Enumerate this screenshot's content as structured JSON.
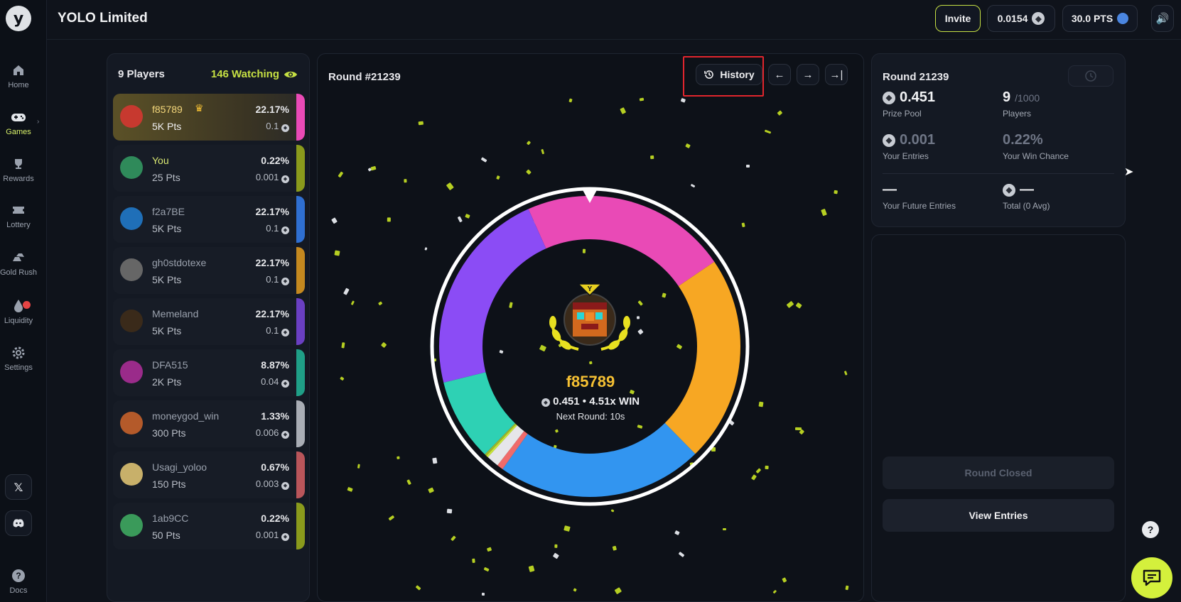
{
  "app": {
    "title": "YOLO Limited",
    "logo_letter": "y"
  },
  "sidebar": {
    "items": [
      {
        "label": "Home",
        "icon": "home-icon"
      },
      {
        "label": "Games",
        "icon": "gamepad-icon",
        "active": true
      },
      {
        "label": "Rewards",
        "icon": "trophy-icon"
      },
      {
        "label": "Lottery",
        "icon": "ticket-icon"
      },
      {
        "label": "Gold Rush",
        "icon": "gold-bars-icon"
      },
      {
        "label": "Liquidity",
        "icon": "drop-icon"
      },
      {
        "label": "Settings",
        "icon": "gear-icon"
      }
    ],
    "docs_label": "Docs",
    "social": [
      "x-icon",
      "discord-icon"
    ]
  },
  "header": {
    "invite_label": "Invite",
    "eth_balance": "0.0154",
    "points": "30.0 PTS",
    "sound_icon": "speaker-icon"
  },
  "players_panel": {
    "count_label": "9 Players",
    "watching_label": "146 Watching",
    "players": [
      {
        "name": "f85789",
        "pts": "5K Pts",
        "pct": "22.17%",
        "amount": "0.1",
        "color": "#e94ab6",
        "winner": true
      },
      {
        "name": "You",
        "pts": "25 Pts",
        "pct": "0.22%",
        "amount": "0.001",
        "color": "#8a9a1c",
        "you": true
      },
      {
        "name": "f2a7BE",
        "pts": "5K Pts",
        "pct": "22.17%",
        "amount": "0.1",
        "color": "#2f6fd1"
      },
      {
        "name": "gh0stdotexe",
        "pts": "5K Pts",
        "pct": "22.17%",
        "amount": "0.1",
        "color": "#c4881f"
      },
      {
        "name": "Memeland",
        "pts": "5K Pts",
        "pct": "22.17%",
        "amount": "0.1",
        "color": "#6a3fc2"
      },
      {
        "name": "DFA515",
        "pts": "2K Pts",
        "pct": "8.87%",
        "amount": "0.04",
        "color": "#1f9f87"
      },
      {
        "name": "moneygod_win",
        "pts": "300 Pts",
        "pct": "1.33%",
        "amount": "0.006",
        "color": "#a9adb5"
      },
      {
        "name": "Usagi_yoloo",
        "pts": "150 Pts",
        "pct": "0.67%",
        "amount": "0.003",
        "color": "#b9555a"
      },
      {
        "name": "1ab9CC",
        "pts": "50 Pts",
        "pct": "0.22%",
        "amount": "0.001",
        "color": "#8a9a1c"
      }
    ]
  },
  "round_panel": {
    "title": "Round #21239",
    "history_label": "History",
    "winner_name": "f85789",
    "winner_amount": "0.451",
    "winner_multiplier": "4.51x WIN",
    "next_round": "Next Round: 10s",
    "wheel_segments": [
      {
        "name": "f85789",
        "share": 22.17,
        "color": "#e94ab6"
      },
      {
        "name": "gh0stdotexe",
        "share": 22.17,
        "color": "#f7a723"
      },
      {
        "name": "f2a7BE",
        "share": 22.17,
        "color": "#3295f0"
      },
      {
        "name": "Usagi_yoloo",
        "share": 0.67,
        "color": "#f06b6b"
      },
      {
        "name": "moneygod_win",
        "share": 1.33,
        "color": "#e6e6ea"
      },
      {
        "name": "You",
        "share": 0.22,
        "color": "#c9e636"
      },
      {
        "name": "1ab9CC",
        "share": 0.22,
        "color": "#9fb52b"
      },
      {
        "name": "DFA515",
        "share": 8.87,
        "color": "#2ed1b4"
      },
      {
        "name": "Memeland",
        "share": 22.17,
        "color": "#8b4cf5"
      }
    ]
  },
  "round_stats": {
    "title": "Round 21239",
    "prize_pool": "0.451",
    "prize_pool_label": "Prize Pool",
    "players": "9",
    "players_max": "/1000",
    "players_label": "Players",
    "your_entries": "0.001",
    "your_entries_label": "Your Entries",
    "win_chance": "0.22%",
    "win_chance_label": "Your Win Chance",
    "future_entries": "—",
    "future_entries_label": "Your Future Entries",
    "total": "—",
    "total_label": "Total (0 Avg)"
  },
  "actions": {
    "round_closed_label": "Round Closed",
    "view_entries_label": "View Entries"
  },
  "help_label": "?"
}
